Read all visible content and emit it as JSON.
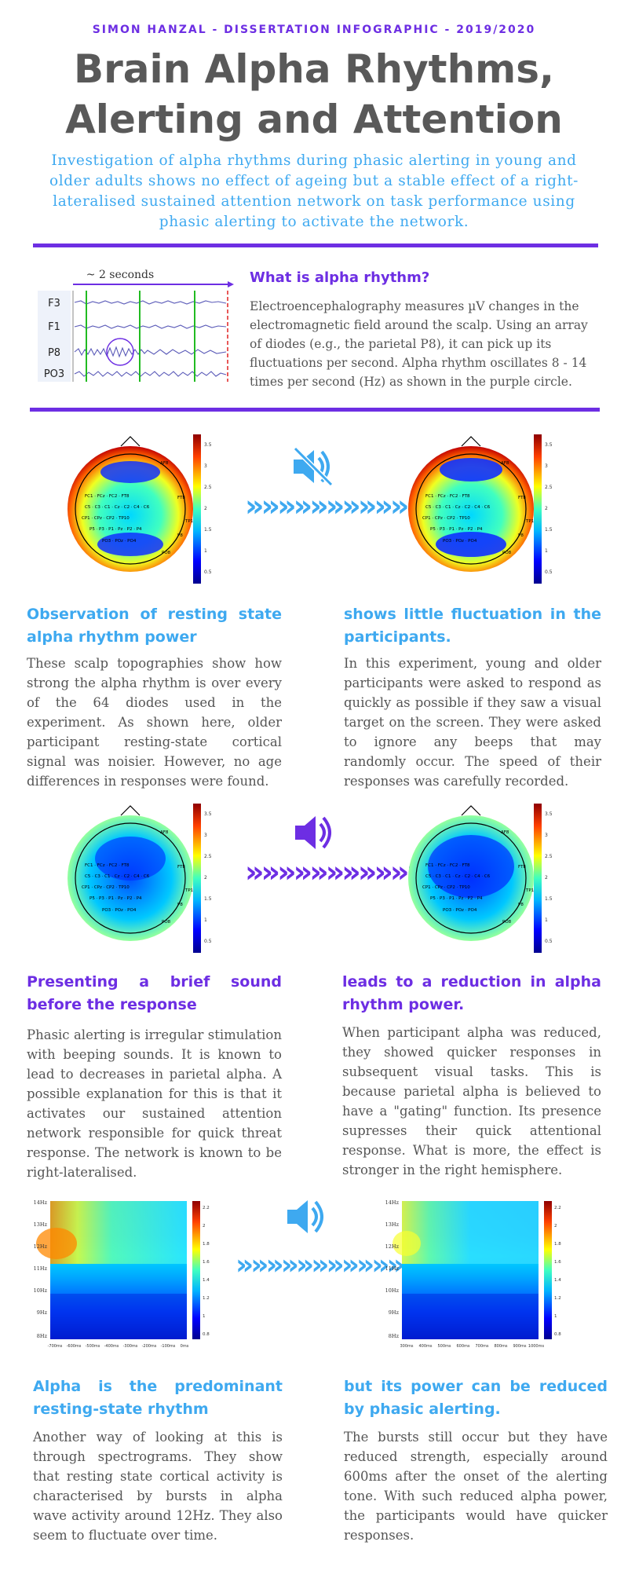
{
  "header": {
    "kicker": "SIMON HANZAL - DISSERTATION INFOGRAPHIC - 2019/2020",
    "title_line1": "Brain Alpha Rhythms,",
    "title_line2": "Alerting and Attention",
    "subtitle": "Investigation of alpha rhythms during phasic alerting in young and older adults shows no effect of ageing but a stable effect of a right-lateralised sustained attention network on task performance using phasic alerting to activate the network."
  },
  "colors": {
    "purple": "#6d2ee3",
    "blue": "#3ea9f0",
    "text": "#555555"
  },
  "intro": {
    "eeg_time_label": "~ 2 seconds",
    "channels": [
      "F3",
      "F1",
      "P8",
      "PO3"
    ],
    "heading": "What is alpha rhythm?",
    "body": "Electroencephalography measures µV changes in the electromagnetic field around the scalp. Using an array of diodes (e.g., the parietal P8), it can pick up its fluctuations per second. Alpha rhythm oscillates 8 - 14 times per second (Hz) as shown in the purple circle."
  },
  "topo_colorbar_ticks_a": [
    "3.5",
    "3",
    "2.5",
    "2",
    "1.5",
    "1",
    "0.5"
  ],
  "topo_colorbar_ticks_b": [
    "3.5",
    "3",
    "2.5",
    "2",
    "1.5",
    "1",
    "0.5"
  ],
  "topo_electrodes": [
    "AF8",
    "FT8",
    "TP10",
    "P8",
    "PO8",
    "T8",
    "C5",
    "C3",
    "C1",
    "Cz",
    "C2",
    "C4",
    "C6",
    "P5",
    "P3",
    "P1",
    "Pz",
    "P2",
    "P4",
    "PO3",
    "POz",
    "PO4",
    "FC1",
    "FC2",
    "FCz",
    "CP1",
    "CP2",
    "CPz"
  ],
  "icons": {
    "muted": "speaker-muted-icon",
    "sound": "speaker-sound-icon",
    "arrow": "chevron-arrows-icon"
  },
  "arrows_text": "»»»»»»»»»»»»",
  "section1": {
    "left_heading": "Observation of resting state alpha rhythm power",
    "left_body": "These scalp topographies show how strong the alpha rhythm is over every of the 64 diodes used in the experiment. As shown here, older participant resting-state cortical signal was noisier. However, no age differences in responses were found.",
    "right_heading": "shows little fluctuation in the participants.",
    "right_body": "In this experiment, young and older participants were asked to respond as quickly as possible if they saw a visual target on the screen. They were asked to ignore any beeps that may randomly occur. The speed of their responses was carefully recorded."
  },
  "section2": {
    "left_heading": "Presenting a brief sound before the response",
    "left_body": "Phasic alerting is irregular stimulation with beeping sounds. It is known to lead to decreases in parietal alpha. A possible explanation for this is that it activates our sustained attention network responsible for quick threat response. The network is known to be right-lateralised.",
    "right_heading": "leads to a reduction in alpha rhythm power.",
    "right_body": "When participant alpha was reduced, they showed quicker responses in subsequent visual tasks. This is because parietal alpha is believed to have a \"gating\" function. Its presence supresses their quick attentional response. What is more, the effect is stronger in the right hemisphere."
  },
  "spectrogram": {
    "y_ticks": [
      "14Hz",
      "13Hz",
      "12Hz",
      "11Hz",
      "10Hz",
      "9Hz",
      "8Hz"
    ],
    "x_ticks_left": [
      "-700ms",
      "-600ms",
      "-500ms",
      "-400ms",
      "-300ms",
      "-200ms",
      "-100ms",
      "0ms"
    ],
    "x_ticks_right": [
      "300ms",
      "400ms",
      "500ms",
      "600ms",
      "700ms",
      "800ms",
      "900ms",
      "1000ms"
    ],
    "colorbar_ticks": [
      "2.2",
      "2",
      "1.8",
      "1.6",
      "1.4",
      "1.2",
      "1",
      "0.8"
    ]
  },
  "section3": {
    "left_heading": "Alpha is the predominant resting-state rhythm",
    "left_body": "Another way of looking at this is through spectrograms. They show that resting state cortical activity is characterised by bursts in alpha wave activity around 12Hz. They also seem to fluctuate over time.",
    "right_heading": "but its power can be reduced by phasic alerting.",
    "right_body": "The bursts still occur but they have reduced strength, especially around 600ms after the onset of the alerting tone. With such reduced alpha power, the participants would have quicker responses."
  }
}
